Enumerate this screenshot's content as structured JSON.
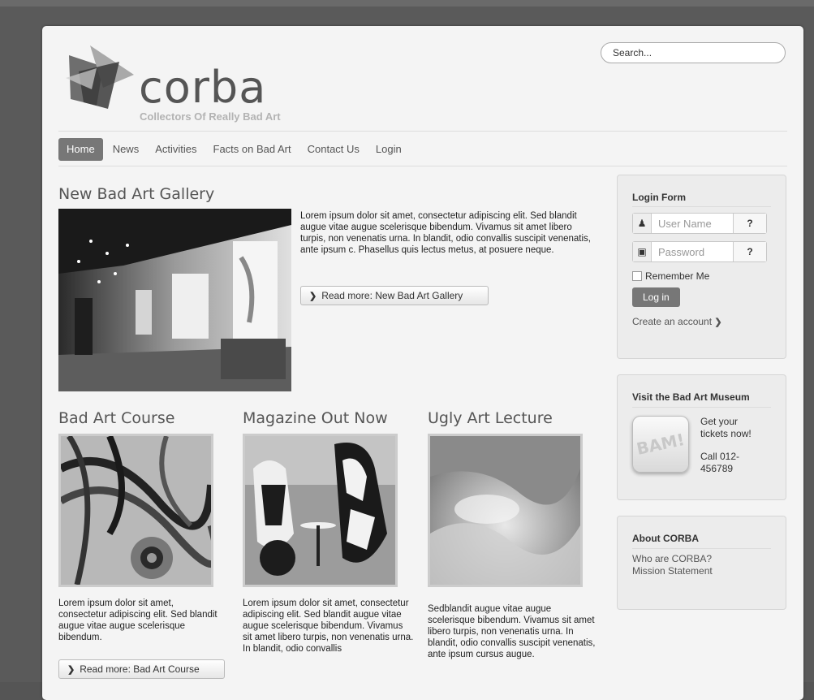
{
  "header": {
    "logo_text": "corba",
    "tagline": "Collectors Of Really Bad Art",
    "search_placeholder": "Search..."
  },
  "nav": {
    "items": [
      "Home",
      "News",
      "Activities",
      "Facts on Bad Art",
      "Contact Us",
      "Login"
    ],
    "active": "Home"
  },
  "featured": {
    "title": "New Bad Art Gallery",
    "body": "Lorem ipsum dolor sit amet, consectetur adipiscing elit. Sed blandit augue vitae augue scelerisque bibendum. Vivamus sit amet libero turpis, non venenatis urna. In blandit, odio convallis suscipit venenatis, ante ipsum c. Phasellus quis lectus metus, at posuere neque.",
    "read_more": "Read more: New Bad Art Gallery"
  },
  "articles": [
    {
      "title": "Bad Art Course",
      "body": "Lorem ipsum dolor sit amet, consectetur adipiscing elit. Sed blandit augue vitae augue scelerisque bibendum.",
      "read_more": "Read more: Bad Art Course"
    },
    {
      "title": "Magazine Out Now",
      "body": "Lorem ipsum dolor sit amet, consectetur adipiscing elit. Sed blandit augue vitae augue scelerisque bibendum. Vivamus sit amet libero turpis, non venenatis urna. In blandit, odio convallis"
    },
    {
      "title": "Ugly Art Lecture",
      "body": "Sedblandit augue vitae augue scelerisque bibendum. Vivamus sit amet libero turpis, non venenatis urna. In blandit, odio convallis suscipit venenatis, ante ipsum cursus augue."
    }
  ],
  "login": {
    "title": "Login Form",
    "username_placeholder": "User Name",
    "password_placeholder": "Password",
    "help_glyph": "?",
    "remember": "Remember Me",
    "submit": "Log in",
    "create": "Create an account"
  },
  "museum": {
    "title": "Visit the Bad Art Museum",
    "badge": "BAM!",
    "tickets": "Get your tickets now!",
    "call": "Call 012-456789"
  },
  "about": {
    "title": "About CORBA",
    "links": [
      "Who are CORBA?",
      "Mission Statement"
    ]
  },
  "colors": {
    "nav_active_bg": "#777777",
    "page_bg": "#5a5a5a",
    "card_bg": "#f4f4f4"
  }
}
